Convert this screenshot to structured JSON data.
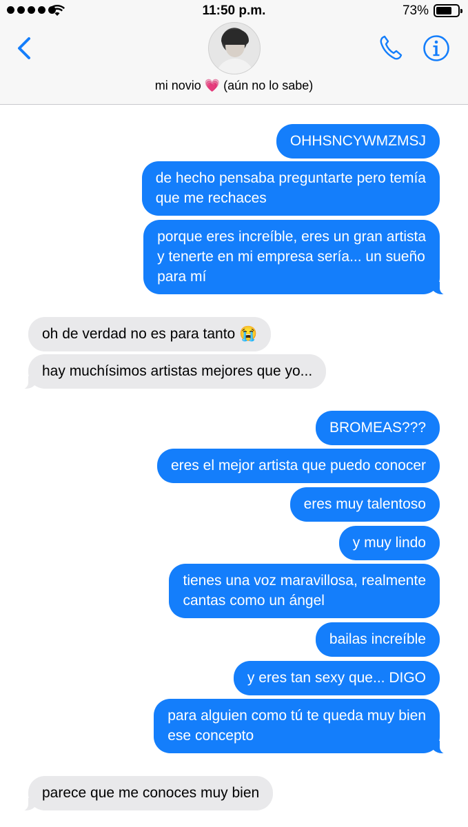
{
  "status_bar": {
    "time": "11:50 p.m.",
    "battery_percent": "73%",
    "battery_level": 0.73,
    "signal_bars": 5
  },
  "header": {
    "contact_name": "mi novio 💗 (aún no lo sabe)",
    "icons": [
      "back-icon",
      "avatar",
      "phone-icon",
      "info-icon"
    ],
    "accent_color": "#147efb"
  },
  "messages": [
    {
      "from": "me",
      "text": "OHHSNCYWMZMSJ"
    },
    {
      "from": "me",
      "text": "de hecho pensaba preguntarte pero temía\nque me rechaces"
    },
    {
      "from": "me",
      "text": "porque eres increíble, eres un gran artista\ny tenerte en mi empresa sería... un sueño\npara mí"
    },
    {
      "from": "them",
      "text": "oh de verdad no es para tanto 😭"
    },
    {
      "from": "them",
      "text": "hay muchísimos artistas mejores que yo..."
    },
    {
      "from": "me",
      "text": "BROMEAS???"
    },
    {
      "from": "me",
      "text": "eres el mejor artista que puedo conocer"
    },
    {
      "from": "me",
      "text": "eres muy talentoso"
    },
    {
      "from": "me",
      "text": "y muy lindo"
    },
    {
      "from": "me",
      "text": "tienes una voz maravillosa, realmente\ncantas como un ángel"
    },
    {
      "from": "me",
      "text": "bailas increíble"
    },
    {
      "from": "me",
      "text": "y eres tan sexy que... DIGO"
    },
    {
      "from": "me",
      "text": "para alguien como tú te queda muy bien\nese concepto"
    },
    {
      "from": "them",
      "text": "parece que me conoces muy bien"
    }
  ],
  "colors": {
    "sent_bubble": "#147efb",
    "received_bubble": "#e9e9eb"
  }
}
